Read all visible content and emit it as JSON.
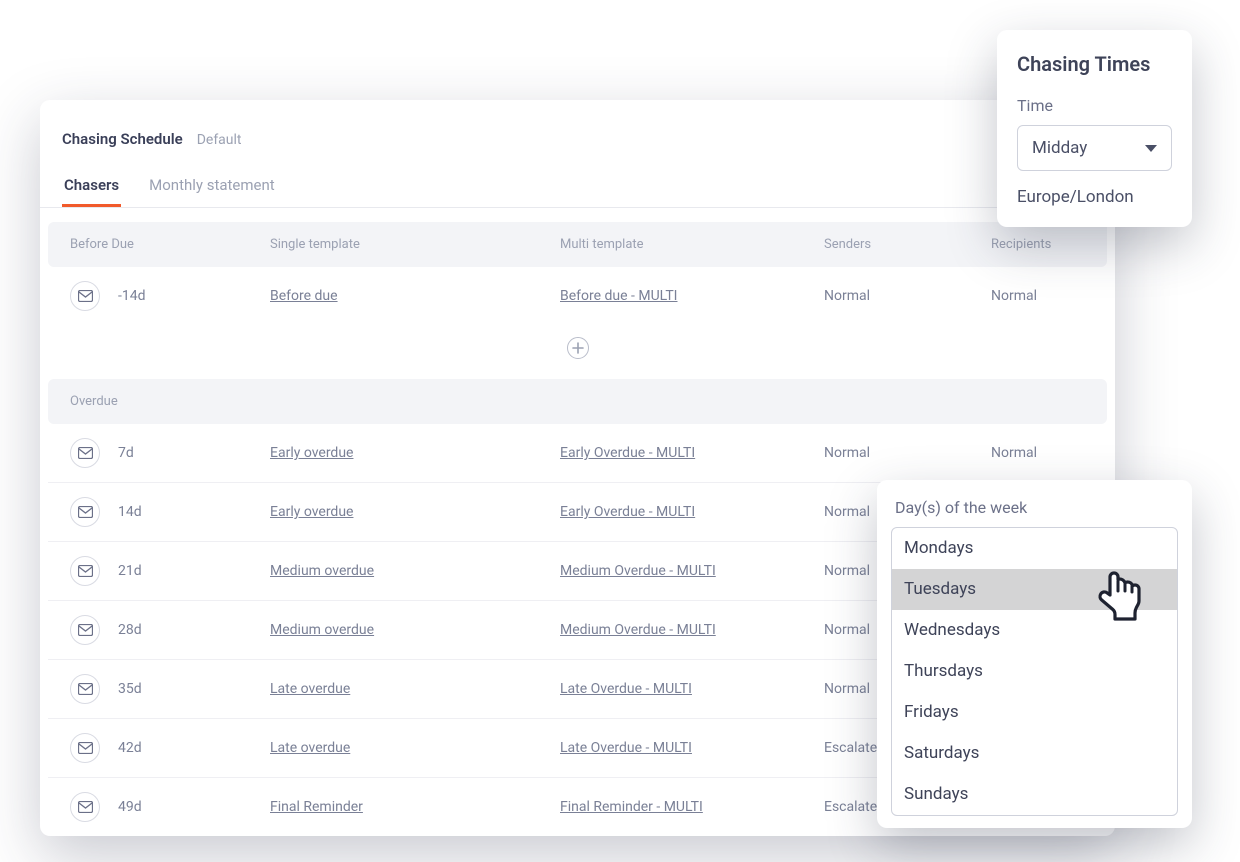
{
  "main": {
    "title": "Chasing Schedule",
    "subtitle": "Default",
    "tabs": [
      {
        "label": "Chasers",
        "active": true
      },
      {
        "label": "Monthly statement",
        "active": false
      }
    ],
    "columns": {
      "before": "Before Due",
      "single": "Single template",
      "multi": "Multi template",
      "senders": "Senders",
      "recipients": "Recipients",
      "overdue": "Overdue"
    },
    "before_rows": [
      {
        "days": "-14d",
        "single": "Before due",
        "multi": "Before due - MULTI",
        "senders": "Normal",
        "recipients": "Normal"
      }
    ],
    "overdue_rows": [
      {
        "days": "7d",
        "single": "Early overdue",
        "multi": "Early Overdue - MULTI",
        "senders": "Normal",
        "recipients": "Normal"
      },
      {
        "days": "14d",
        "single": "Early overdue",
        "multi": "Early Overdue - MULTI",
        "senders": "Normal",
        "recipients": ""
      },
      {
        "days": "21d",
        "single": "Medium overdue",
        "multi": "Medium Overdue - MULTI",
        "senders": "Normal",
        "recipients": ""
      },
      {
        "days": "28d",
        "single": "Medium overdue",
        "multi": "Medium Overdue - MULTI",
        "senders": "Normal",
        "recipients": ""
      },
      {
        "days": "35d",
        "single": "Late overdue",
        "multi": "Late Overdue - MULTI",
        "senders": "Normal",
        "recipients": ""
      },
      {
        "days": "42d",
        "single": "Late overdue",
        "multi": "Late Overdue - MULTI",
        "senders": "Escalated",
        "recipients": ""
      },
      {
        "days": "49d",
        "single": "Final Reminder",
        "multi": "Final Reminder - MULTI",
        "senders": "Escalated",
        "recipients": ""
      }
    ]
  },
  "times_panel": {
    "title": "Chasing Times",
    "time_label": "Time",
    "time_value": "Midday",
    "timezone": "Europe/London"
  },
  "days_panel": {
    "label": "Day(s) of the week",
    "items": [
      "Mondays",
      "Tuesdays",
      "Wednesdays",
      "Thursdays",
      "Fridays",
      "Saturdays",
      "Sundays"
    ],
    "hovered": "Tuesdays"
  }
}
